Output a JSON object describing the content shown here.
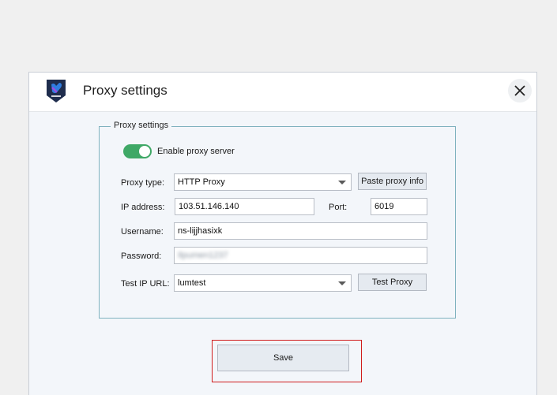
{
  "dialog": {
    "title": "Proxy settings",
    "close_icon": "close-icon",
    "logo_icon": "app-shield-logo-icon"
  },
  "group": {
    "legend": "Proxy settings",
    "toggle": {
      "label": "Enable proxy server",
      "on": true,
      "color": "#3fa866"
    },
    "proxy_type": {
      "label": "Proxy type:",
      "value": "HTTP Proxy"
    },
    "paste_button": "Paste proxy info",
    "ip": {
      "label": "IP address:",
      "value": "103.51.146.140"
    },
    "port": {
      "label": "Port:",
      "value": "6019"
    },
    "username": {
      "label": "Username:",
      "value": "ns-lijjhasixk"
    },
    "password": {
      "label": "Password:",
      "value": "Ilpumen1237"
    },
    "test_url": {
      "label": "Test IP URL:",
      "value": "lumtest"
    },
    "test_button": "Test Proxy"
  },
  "save_button": "Save",
  "colors": {
    "accent_green": "#3fa866",
    "group_border": "#7fb2bf",
    "highlight_red": "#d01c1c"
  }
}
